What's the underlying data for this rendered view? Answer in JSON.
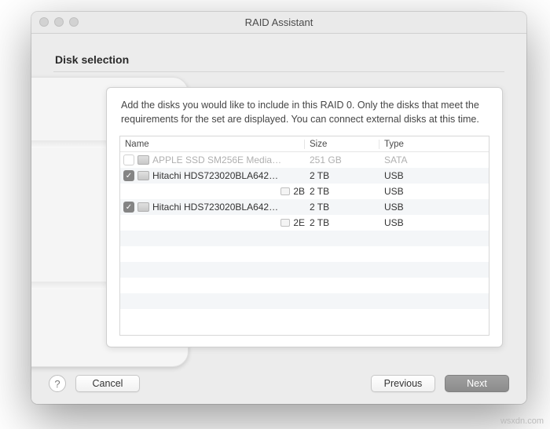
{
  "window": {
    "title": "RAID Assistant"
  },
  "page": {
    "heading": "Disk selection",
    "instructions": "Add the disks you would like to include in this RAID 0. Only the disks that meet the requirements for the set are displayed. You can connect external disks at this time."
  },
  "table": {
    "columns": {
      "name": "Name",
      "size": "Size",
      "type": "Type"
    },
    "rows": [
      {
        "check": "blank",
        "indent": 0,
        "icon": "disk",
        "name": "APPLE SSD SM256E Media…",
        "size": "251 GB",
        "type": "SATA",
        "dim": true
      },
      {
        "check": "checked",
        "indent": 0,
        "icon": "disk",
        "name": "Hitachi HDS723020BLA642…",
        "size": "2 TB",
        "type": "USB",
        "dim": false
      },
      {
        "check": "none",
        "indent": 1,
        "icon": "vol",
        "name": "2B",
        "size": "2 TB",
        "type": "USB",
        "dim": false
      },
      {
        "check": "checked",
        "indent": 0,
        "icon": "disk",
        "name": "Hitachi HDS723020BLA642…",
        "size": "2 TB",
        "type": "USB",
        "dim": false
      },
      {
        "check": "none",
        "indent": 1,
        "icon": "vol",
        "name": "2E",
        "size": "2 TB",
        "type": "USB",
        "dim": false
      }
    ]
  },
  "buttons": {
    "help": "?",
    "cancel": "Cancel",
    "previous": "Previous",
    "next": "Next"
  },
  "watermark": "wsxdn.com"
}
